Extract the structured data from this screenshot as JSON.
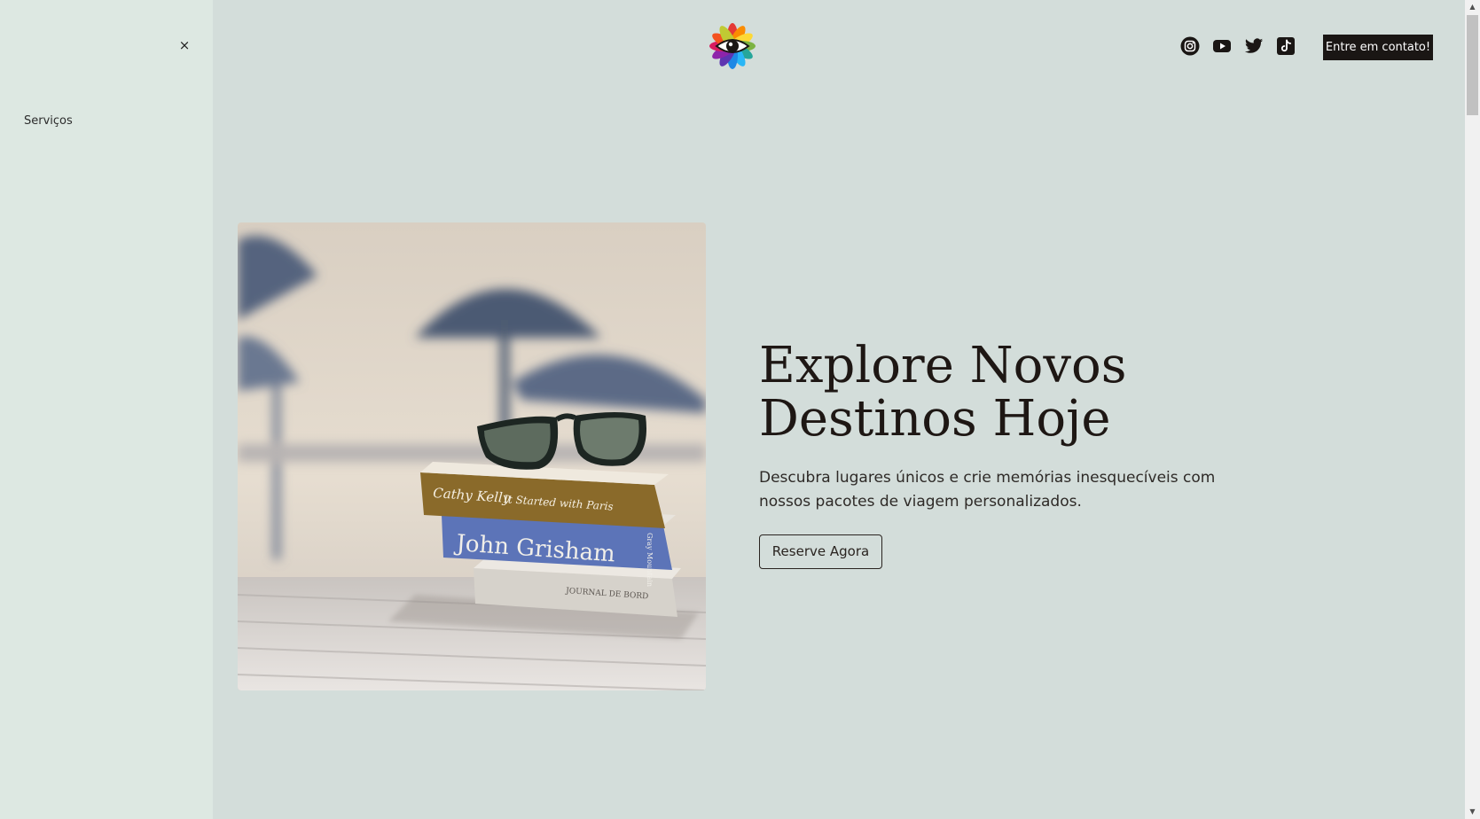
{
  "sidebar": {
    "close_icon": "×",
    "items": [
      {
        "label": "Serviços"
      }
    ]
  },
  "header": {
    "logo_icon": "eye-flower-logo",
    "social": [
      {
        "icon": "instagram-icon"
      },
      {
        "icon": "youtube-icon"
      },
      {
        "icon": "twitter-icon"
      },
      {
        "icon": "tiktok-icon"
      }
    ],
    "cta_label": "Entre em contato!"
  },
  "hero": {
    "image": "sunglasses-on-books-beach-photo",
    "title": "Explore Novos Destinos Hoje",
    "subtitle": "Descubra lugares únicos e crie memórias inesquecíveis com nossos pacotes de viagem personalizados.",
    "button_label": "Reserve Agora",
    "book_titles": [
      "Cathy Kelly",
      "It Started with Paris",
      "John Grisham",
      "Gray Mountain",
      "JOURNAL DE BORD"
    ]
  },
  "colors": {
    "background": "#d3ddda",
    "sidebar_bg": "#dde8e2",
    "cta_bg": "#1a1614",
    "text": "#1e1714"
  }
}
